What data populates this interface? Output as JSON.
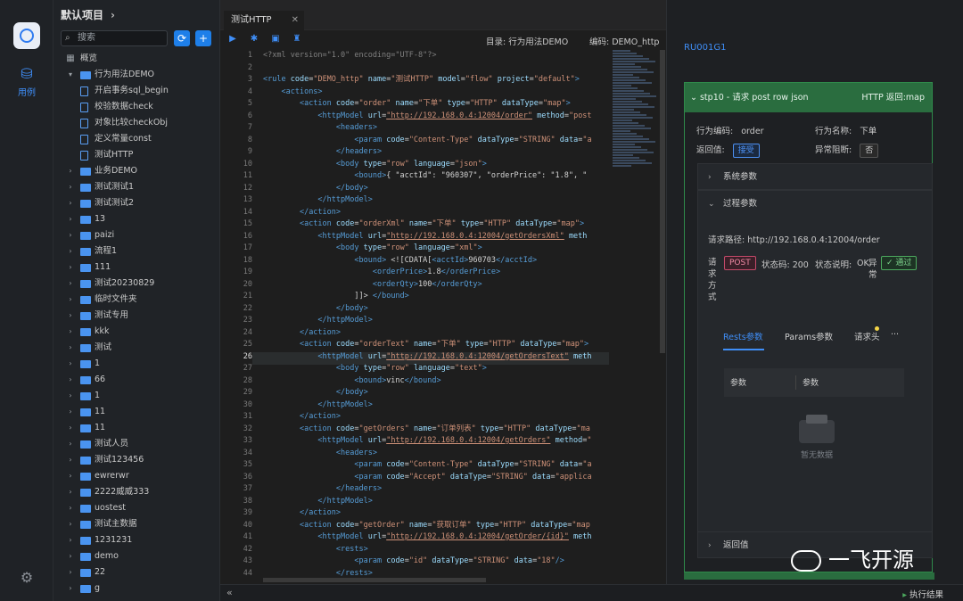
{
  "rail": {
    "nav_label": "用例"
  },
  "tree": {
    "title": "默认项目",
    "search_placeholder": "搜索",
    "items": [
      {
        "label": "概览",
        "kind": "grid",
        "level": 0
      },
      {
        "label": "行为用法DEMO",
        "kind": "folder",
        "level": 0,
        "expanded": true
      },
      {
        "label": "开启事务sql_begin",
        "kind": "doc",
        "level": 1
      },
      {
        "label": "校验数据check",
        "kind": "doc",
        "level": 1
      },
      {
        "label": "对象比较checkObj",
        "kind": "doc",
        "level": 1
      },
      {
        "label": "定义常量const",
        "kind": "doc",
        "level": 1
      },
      {
        "label": "测试HTTP",
        "kind": "doc",
        "level": 1
      },
      {
        "label": "业务DEMO",
        "kind": "folder",
        "level": 0
      },
      {
        "label": "测试测试1",
        "kind": "folder",
        "level": 0
      },
      {
        "label": "测试测试2",
        "kind": "folder",
        "level": 0
      },
      {
        "label": "13",
        "kind": "folder",
        "level": 0
      },
      {
        "label": "paizi",
        "kind": "folder",
        "level": 0
      },
      {
        "label": "流程1",
        "kind": "folder",
        "level": 0
      },
      {
        "label": "111",
        "kind": "folder",
        "level": 0
      },
      {
        "label": "测试20230829",
        "kind": "folder",
        "level": 0
      },
      {
        "label": "临时文件夹",
        "kind": "folder",
        "level": 0
      },
      {
        "label": "测试专用",
        "kind": "folder",
        "level": 0
      },
      {
        "label": "kkk",
        "kind": "folder",
        "level": 0
      },
      {
        "label": "测试",
        "kind": "folder",
        "level": 0
      },
      {
        "label": "1",
        "kind": "folder",
        "level": 0
      },
      {
        "label": "66",
        "kind": "folder",
        "level": 0
      },
      {
        "label": "1",
        "kind": "folder",
        "level": 0
      },
      {
        "label": "11",
        "kind": "folder",
        "level": 0
      },
      {
        "label": "11",
        "kind": "folder",
        "level": 0
      },
      {
        "label": "测试人员",
        "kind": "folder",
        "level": 0
      },
      {
        "label": "测试123456",
        "kind": "folder",
        "level": 0
      },
      {
        "label": "ewrerwr",
        "kind": "folder",
        "level": 0
      },
      {
        "label": "2222威威333",
        "kind": "folder",
        "level": 0
      },
      {
        "label": "uostest",
        "kind": "folder",
        "level": 0
      },
      {
        "label": "测试主数据",
        "kind": "folder",
        "level": 0
      },
      {
        "label": "1231231",
        "kind": "folder",
        "level": 0
      },
      {
        "label": "demo",
        "kind": "folder",
        "level": 0
      },
      {
        "label": "22",
        "kind": "folder",
        "level": 0
      },
      {
        "label": "g",
        "kind": "folder",
        "level": 0
      }
    ]
  },
  "editor": {
    "tab_label": "测试HTTP",
    "directory": "目录: 行为用法DEMO",
    "code": "编码: DEMO_http",
    "current_line": 26
  },
  "right": {
    "rule_id": "RU001G1",
    "step_title": "stp10 - 请求 post row json",
    "step_result": "HTTP 返回:map",
    "action_code_label": "行为编码:",
    "action_code_value": "order",
    "action_name_label": "行为名称:",
    "action_name_value": "下单",
    "return_label": "返回值:",
    "return_value": "接受",
    "block_label": "异常阻断:",
    "block_value": "否",
    "system_params": "系统参数",
    "process_params": "过程参数",
    "request_path": "请求路径: http://192.168.0.4:12004/order",
    "request_method_label": "请求方式",
    "request_method": "POST",
    "status_code": "状态码: 200",
    "status_desc_label": "状态说明:",
    "status_desc": "OK",
    "exception_label": "异常",
    "exception_value": "通过",
    "sub_tabs": [
      "Rests参数",
      "Params参数",
      "请求头",
      "···"
    ],
    "table_headers": [
      "参数",
      "参数"
    ],
    "empty_text": "暂无数据",
    "return_section": "返回值"
  },
  "statusbar": {
    "run_result": "执行结果"
  },
  "watermark": {
    "text": "一飞开源"
  }
}
